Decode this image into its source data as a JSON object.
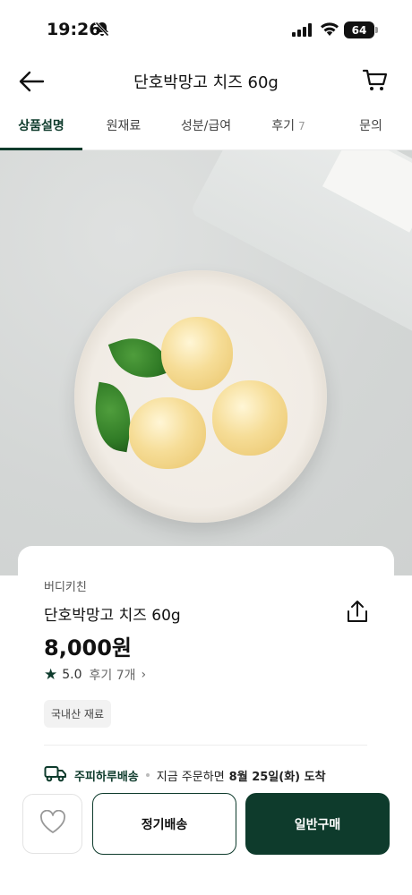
{
  "status_bar": {
    "time": "19:26",
    "battery": "64"
  },
  "header": {
    "title": "단호박망고 치즈 60g"
  },
  "tabs": [
    {
      "label": "상품설명",
      "active": true
    },
    {
      "label": "원재료"
    },
    {
      "label": "성분/급여"
    },
    {
      "label": "후기",
      "count": "7"
    },
    {
      "label": "문의"
    }
  ],
  "product": {
    "brand": "버디키친",
    "name": "단호박망고 치즈 60g",
    "price": "8,000원",
    "rating": "5.0",
    "review_label": "후기 7개",
    "tag": "국내산 재료"
  },
  "delivery": {
    "name": "주피하루배송",
    "text_prefix": "지금 주문하면",
    "date": "8월 25일(화) 도착"
  },
  "actions": {
    "subscribe_label": "정기배송",
    "buy_label": "일반구매"
  },
  "colors": {
    "accent": "#0e3b2c"
  }
}
